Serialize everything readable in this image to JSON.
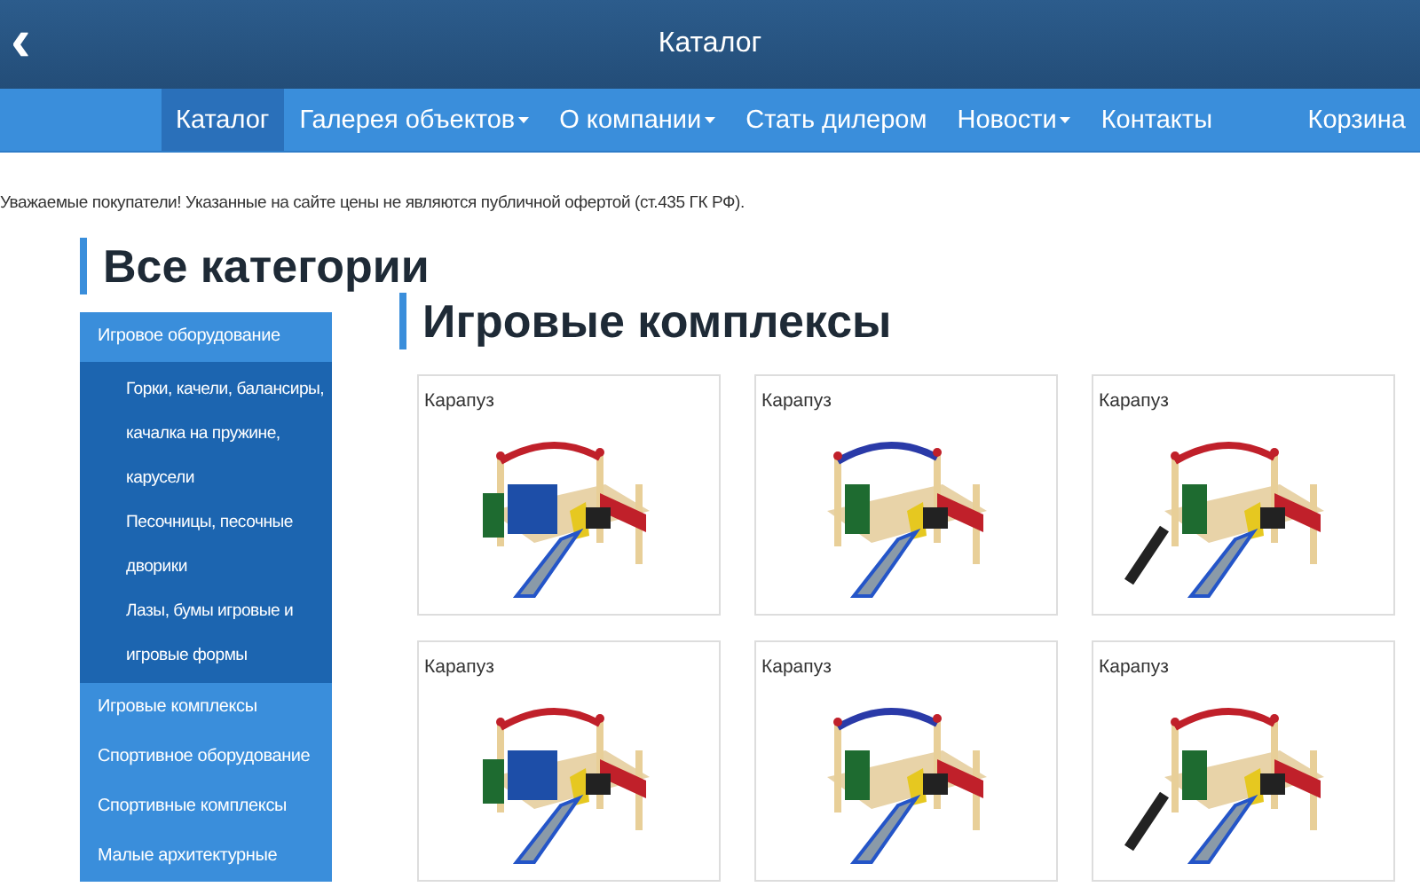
{
  "header": {
    "back": "‹",
    "title": "Каталог"
  },
  "nav": [
    {
      "label": "Каталог",
      "selected": true,
      "dropdown": false
    },
    {
      "label": "Галерея объектов",
      "selected": false,
      "dropdown": true
    },
    {
      "label": "О компании",
      "selected": false,
      "dropdown": true
    },
    {
      "label": "Стать дилером",
      "selected": false,
      "dropdown": false
    },
    {
      "label": "Новости",
      "selected": false,
      "dropdown": true
    },
    {
      "label": "Контакты",
      "selected": false,
      "dropdown": false
    },
    {
      "label": "Корзина",
      "selected": false,
      "dropdown": false
    }
  ],
  "notice": "Уважаемые покупатели! Указанные на сайте цены не являются публичной офертой (ст.435 ГК РФ).",
  "sidebar": {
    "title": "Все категории",
    "items": [
      {
        "label": "Игровое оборудование",
        "expanded": true,
        "children": [
          {
            "label": "Горки, качели, балансиры, качалка на пружине, карусели"
          },
          {
            "label": "Песочницы, песочные дворики"
          },
          {
            "label": "Лазы, бумы игровые и игровые формы"
          }
        ]
      },
      {
        "label": "Игровые комплексы"
      },
      {
        "label": "Спортивное оборудование"
      },
      {
        "label": "Спортивные комплексы"
      },
      {
        "label": "Малые архитектурные"
      }
    ]
  },
  "main": {
    "title": "Игровые комплексы",
    "products": [
      {
        "name": "Карапуз",
        "kind": "picture"
      },
      {
        "name": "Карапуз",
        "kind": "picture"
      },
      {
        "name": "Карапуз",
        "kind": "picture"
      },
      {
        "name": "Карапуз",
        "kind": "picture"
      },
      {
        "name": "Карапуз",
        "kind": "picture"
      },
      {
        "name": "Карапуз",
        "kind": "picture"
      }
    ]
  }
}
